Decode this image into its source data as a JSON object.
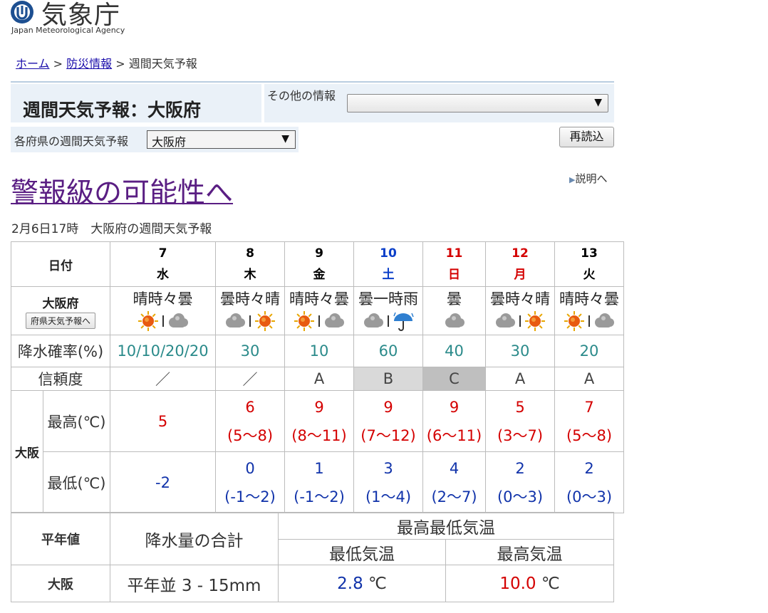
{
  "header": {
    "logo_name": "気象庁",
    "logo_sub": "Japan Meteorological Agency"
  },
  "breadcrumb": {
    "home": "ホーム",
    "sep1": " > ",
    "disaster": "防災情報",
    "sep2": " > ",
    "current": "週間天気予報"
  },
  "title_panel": {
    "title": "週間天気予報：大阪府",
    "other_info_label": "その他の情報",
    "other_info_value": "",
    "pref_label": "各府県の週間天気予報",
    "pref_value": "大阪府",
    "reload_label": "再読込"
  },
  "headline": "警報級の可能性へ",
  "explain_link": "説明へ",
  "issued": "2月6日17時　大阪府の週間天気予報",
  "forecast": {
    "date_header": "日付",
    "area_name": "大阪府",
    "pref_forecast_button": "府県天気予報へ",
    "pop_label": "降水確率(%)",
    "reliability_label": "信頼度",
    "city_name": "大阪",
    "max_label": "最高(℃)",
    "min_label": "最低(℃)",
    "days": [
      {
        "date": "7",
        "dow": "水",
        "dow_color": "black",
        "weather": "晴時々曇",
        "icon_a": "sun-icon",
        "icon_b": "cloud-icon",
        "pop": "10/10/20/20",
        "rel": "／",
        "rel_bg": "",
        "max": "5",
        "max_range": "",
        "min": "-2",
        "min_range": ""
      },
      {
        "date": "8",
        "dow": "木",
        "dow_color": "black",
        "weather": "曇時々晴",
        "icon_a": "cloud-icon",
        "icon_b": "sun-icon",
        "pop": "30",
        "rel": "／",
        "rel_bg": "",
        "max": "6",
        "max_range": "(5～8)",
        "min": "0",
        "min_range": "(-1～2)"
      },
      {
        "date": "9",
        "dow": "金",
        "dow_color": "black",
        "weather": "晴時々曇",
        "icon_a": "sun-icon",
        "icon_b": "cloud-icon",
        "pop": "10",
        "rel": "A",
        "rel_bg": "",
        "max": "9",
        "max_range": "(8～11)",
        "min": "1",
        "min_range": "(-1～2)"
      },
      {
        "date": "10",
        "dow": "土",
        "dow_color": "#0b3fc9",
        "weather": "曇一時雨",
        "icon_a": "cloud-icon",
        "icon_b": "umbrella-icon",
        "pop": "60",
        "rel": "B",
        "rel_bg": "#d9d9d9",
        "max": "9",
        "max_range": "(7～12)",
        "min": "3",
        "min_range": "(1～4)"
      },
      {
        "date": "11",
        "dow": "日",
        "dow_color": "#d40000",
        "weather": "曇",
        "icon_a": "cloud-icon",
        "icon_b": "",
        "pop": "40",
        "rel": "C",
        "rel_bg": "#bfbfbf",
        "max": "9",
        "max_range": "(6～11)",
        "min": "4",
        "min_range": "(2～7)"
      },
      {
        "date": "12",
        "dow": "月",
        "dow_color": "#d40000",
        "weather": "曇時々晴",
        "icon_a": "cloud-icon",
        "icon_b": "sun-icon",
        "pop": "30",
        "rel": "A",
        "rel_bg": "",
        "max": "5",
        "max_range": "(3～7)",
        "min": "2",
        "min_range": "(0～3)"
      },
      {
        "date": "13",
        "dow": "火",
        "dow_color": "black",
        "weather": "晴時々曇",
        "icon_a": "sun-icon",
        "icon_b": "cloud-icon",
        "pop": "20",
        "rel": "A",
        "rel_bg": "",
        "max": "7",
        "max_range": "(5～8)",
        "min": "2",
        "min_range": "(0～3)"
      }
    ]
  },
  "normals": {
    "header": "平年値",
    "precip_header": "降水量の合計",
    "temp_header": "最高最低気温",
    "min_header": "最低気温",
    "max_header": "最高気温",
    "city": "大阪",
    "precip_value": "平年並 3 - 15mm",
    "min_value": "2.8",
    "max_value": "10.0",
    "unit": "℃"
  },
  "colors": {
    "panel_bg": "#eaf1f8",
    "headline": "#5a1e83",
    "link": "#1a0dab",
    "pop": "#2a8a8a",
    "max_temp": "#d40000",
    "min_temp": "#1133aa"
  }
}
